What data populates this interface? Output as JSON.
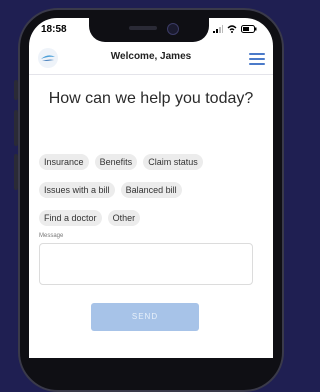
{
  "status_bar": {
    "time": "18:58",
    "icons": [
      "signal-icon",
      "wifi-icon",
      "battery-icon"
    ]
  },
  "header": {
    "title": "Welcome, James",
    "logo_icon": "company-logo-icon",
    "menu_icon": "hamburger-menu-icon"
  },
  "main": {
    "headline": "How can we help you today?",
    "topics": [
      "Insurance",
      "Benefits",
      "Claim status",
      "Issues with a bill",
      "Balanced bill",
      "Find a doctor",
      "Other"
    ],
    "message_label": "Message",
    "message_value": "",
    "send_label": "SEND"
  },
  "colors": {
    "background": "#1f1f52",
    "accent": "#4b7ac9",
    "send_button": "#a7c3e8",
    "chip": "#ececec"
  }
}
